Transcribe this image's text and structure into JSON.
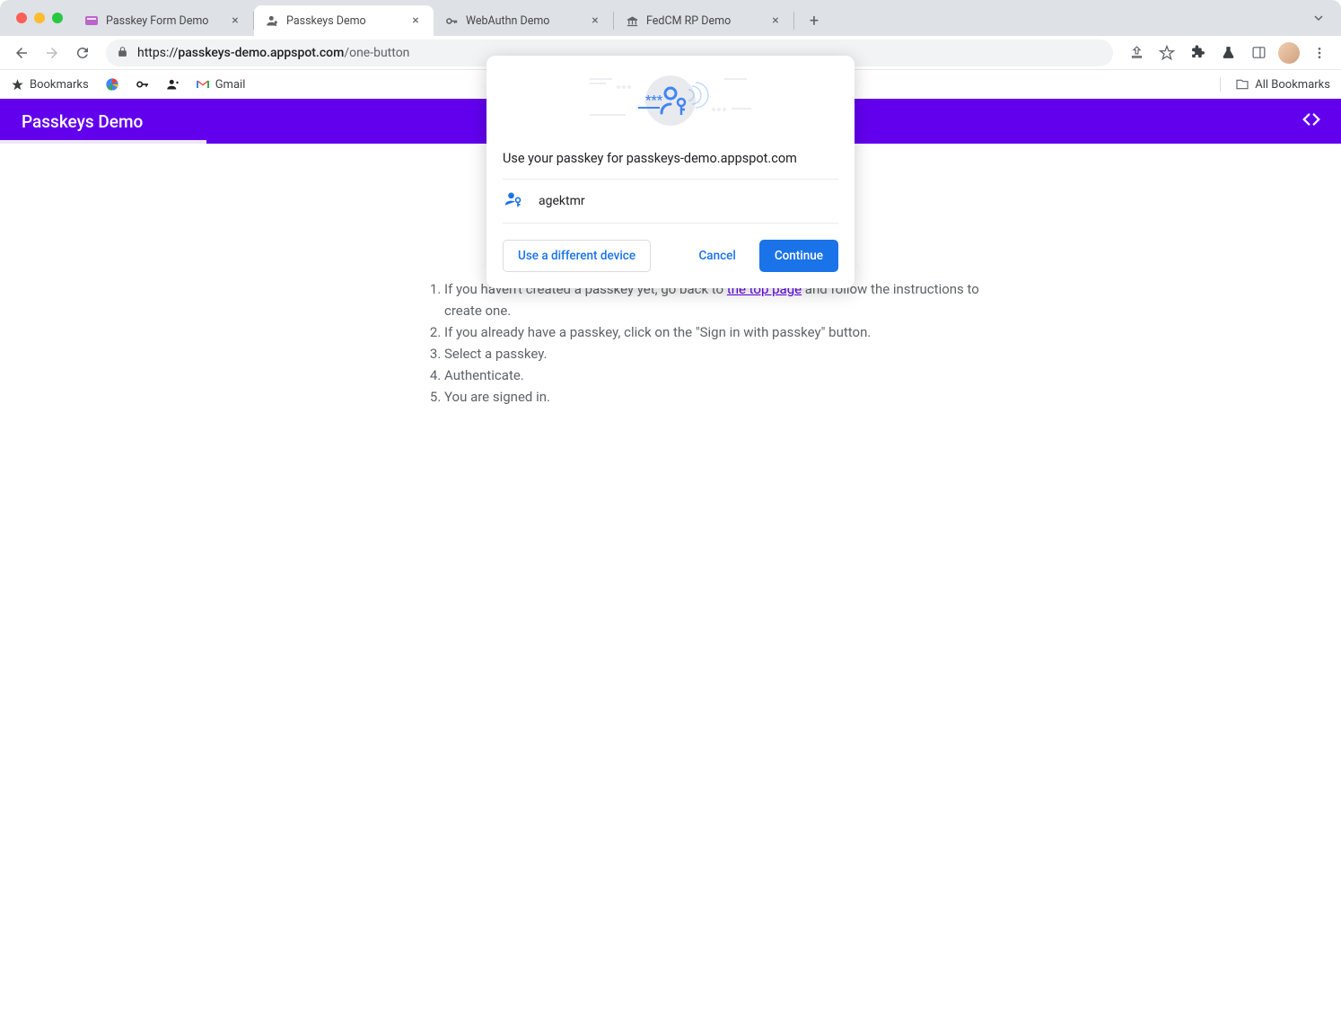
{
  "tabs": [
    {
      "title": "Passkey Form Demo",
      "active": false
    },
    {
      "title": "Passkeys Demo",
      "active": true
    },
    {
      "title": "WebAuthn Demo",
      "active": false
    },
    {
      "title": "FedCM RP Demo",
      "active": false
    }
  ],
  "url": {
    "protocol": "https://",
    "domain": "passkeys-demo.appspot.com",
    "path": "/one-button"
  },
  "bookmarks": {
    "list_label": "Bookmarks",
    "gmail_label": "Gmail",
    "all_label": "All Bookmarks"
  },
  "header": {
    "title": "Passkeys Demo"
  },
  "content": {
    "items": [
      {
        "prefix": "If you haven't created a passkey yet, go back to ",
        "link": "the top page",
        "suffix": " and follow the instructions to create one."
      },
      {
        "text": "If you already have a passkey, click on the \"Sign in with passkey\" button."
      },
      {
        "text": "Select a passkey."
      },
      {
        "text": "Authenticate."
      },
      {
        "text": "You are signed in."
      }
    ]
  },
  "modal": {
    "prompt": "Use your passkey for passkeys-demo.appspot.com",
    "account": "agektmr",
    "use_different": "Use a different device",
    "cancel": "Cancel",
    "continue": "Continue"
  }
}
